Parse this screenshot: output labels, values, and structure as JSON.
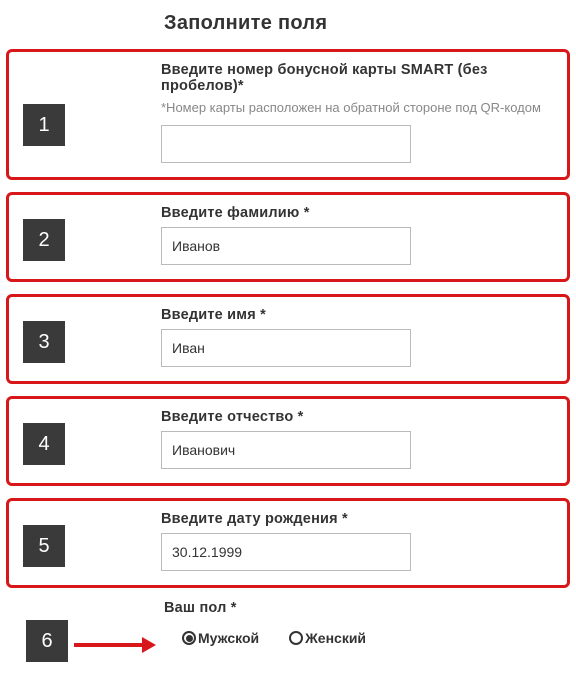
{
  "title": "Заполните поля",
  "steps": {
    "s1": {
      "num": "1",
      "label": "Введите номер бонусной карты SMART (без пробелов)*",
      "hint": "*Номер карты расположен на обратной стороне под QR-кодом",
      "value": ""
    },
    "s2": {
      "num": "2",
      "label": "Введите фамилию *",
      "value": "Иванов"
    },
    "s3": {
      "num": "3",
      "label": "Введите имя *",
      "value": "Иван"
    },
    "s4": {
      "num": "4",
      "label": "Введите отчество *",
      "value": "Иванович"
    },
    "s5": {
      "num": "5",
      "label": "Введите дату рождения *",
      "value": "30.12.1999"
    }
  },
  "gender": {
    "num": "6",
    "label": "Ваш пол *",
    "options": {
      "male": "Мужской",
      "female": "Женский"
    },
    "selected": "male"
  }
}
